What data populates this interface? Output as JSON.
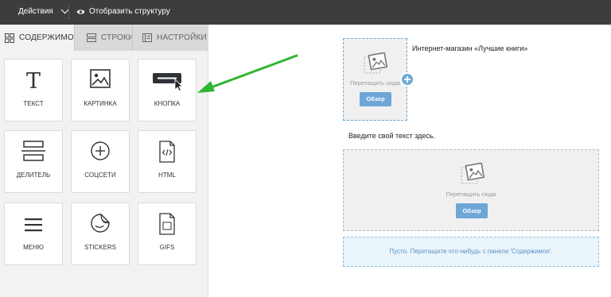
{
  "topbar": {
    "actions_label": "Действия",
    "structure_label": "Отобразить структуру"
  },
  "tabs": [
    {
      "label": "Содержимое",
      "icon": "grid-icon",
      "active": true
    },
    {
      "label": "Строки",
      "icon": "rows-icon",
      "active": false
    },
    {
      "label": "Настройки",
      "icon": "settings-panel-icon",
      "active": false
    }
  ],
  "tiles": [
    {
      "label": "ТЕКСТ",
      "icon": "text-icon"
    },
    {
      "label": "КАРТИНКА",
      "icon": "image-icon"
    },
    {
      "label": "КНОПКА",
      "icon": "button-icon"
    },
    {
      "label": "ДЕЛИТЕЛЬ",
      "icon": "divider-icon"
    },
    {
      "label": "СОЦСЕТИ",
      "icon": "social-plus-icon"
    },
    {
      "label": "HTML",
      "icon": "html-file-icon"
    },
    {
      "label": "МЕНЮ",
      "icon": "menu-icon"
    },
    {
      "label": "STICKERS",
      "icon": "sticker-icon"
    },
    {
      "label": "GIFS",
      "icon": "gif-file-icon"
    }
  ],
  "canvas": {
    "store_title": "Интернет-магазин «Лучшие книги»",
    "drop_hint": "Перетащить сюда",
    "browse_label": "Обзор",
    "intro_text": "Введите свой текст здесь.",
    "empty_row_text": "Пусто. Перетащите что-нибудь с панели 'Содержимое'."
  },
  "colors": {
    "topbar": "#3d3d3d",
    "accent_blue": "#6aaad6",
    "arrow_green": "#2fb52f"
  }
}
